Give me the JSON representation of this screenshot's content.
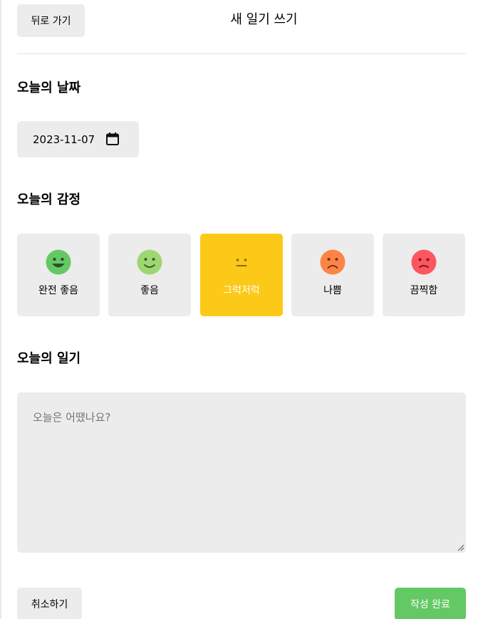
{
  "header": {
    "back_label": "뒤로 가기",
    "title": "새 일기 쓰기"
  },
  "date_section": {
    "title": "오늘의 날짜",
    "date_value": "2023-11-07",
    "icon": "calendar-icon"
  },
  "emotion_section": {
    "title": "오늘의 감정",
    "items": [
      {
        "label": "완전 좋음",
        "color": "#64c964",
        "icon": "very-happy-face-icon",
        "selected": false
      },
      {
        "label": "좋음",
        "color": "#9dd772",
        "icon": "happy-face-icon",
        "selected": false
      },
      {
        "label": "그럭저럭",
        "color": "#fcc918",
        "icon": "neutral-face-icon",
        "selected": true
      },
      {
        "label": "나쁨",
        "color": "#fd8446",
        "icon": "sad-face-icon",
        "selected": false
      },
      {
        "label": "끔찍함",
        "color": "#fd565f",
        "icon": "very-sad-face-icon",
        "selected": false
      }
    ]
  },
  "diary_section": {
    "title": "오늘의 일기",
    "placeholder": "오늘은 어땠나요?",
    "value": ""
  },
  "footer": {
    "cancel_label": "취소하기",
    "submit_label": "작성 완료"
  },
  "colors": {
    "button_bg": "#ececec",
    "accent_green": "#64c964",
    "selected_yellow": "#fcc918"
  }
}
